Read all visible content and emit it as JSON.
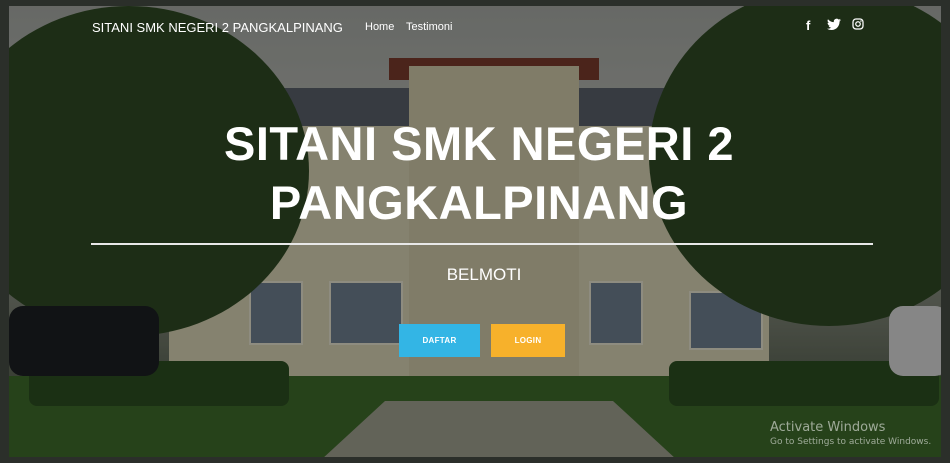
{
  "navbar": {
    "brand": "SITANI SMK NEGERI 2 PANGKALPINANG",
    "links": [
      {
        "label": "Home"
      },
      {
        "label": "Testimoni"
      }
    ],
    "social": [
      {
        "icon": "facebook-icon",
        "glyph": "f"
      },
      {
        "icon": "twitter-icon",
        "glyph": "🐦"
      },
      {
        "icon": "instagram-icon",
        "glyph": "◎"
      }
    ]
  },
  "hero": {
    "title_line1": "SITANI SMK NEGERI 2",
    "title_line2": "PANGKALPINANG",
    "subtitle": "BELMOTI",
    "buttons": {
      "daftar": "DAFTAR",
      "login": "LOGIN"
    }
  },
  "colors": {
    "daftar_button": "#33b5e5",
    "login_button": "#f7b12b"
  },
  "os_watermark": {
    "title": "Activate Windows",
    "subtitle": "Go to Settings to activate Windows."
  }
}
